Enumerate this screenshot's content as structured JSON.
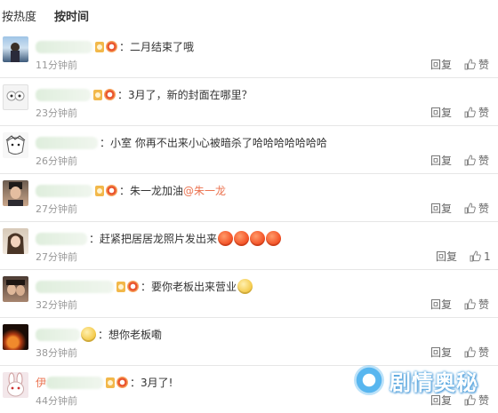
{
  "sort": {
    "hot": "按热度",
    "time": "按时间"
  },
  "actions": {
    "reply": "回复",
    "like": "赞"
  },
  "colors": {
    "mention": "#eb7350",
    "time": "#999999",
    "divider": "#e6e6e6"
  },
  "comments": [
    {
      "text": "：二月结束了哦",
      "time": "11分钟前"
    },
    {
      "text": "：3月了，新的封面在哪里？",
      "time": "23分钟前"
    },
    {
      "text": "：小室 你再不出来小心被暗杀了哈哈哈哈哈哈哈",
      "time": "26分钟前"
    },
    {
      "text": "：朱一龙加油",
      "mention": "@朱一龙",
      "time": "27分钟前"
    },
    {
      "text": "：赶紧把居居龙照片发出来",
      "time": "27分钟前"
    },
    {
      "text": "：要你老板出来营业",
      "time": "32分钟前"
    },
    {
      "text": "：想你老板嘞",
      "time": "38分钟前"
    },
    {
      "name_prefix": "伊",
      "text": "：3月了!",
      "time": "44分钟前"
    }
  ],
  "watermark": {
    "text": "剧情奥秘"
  }
}
